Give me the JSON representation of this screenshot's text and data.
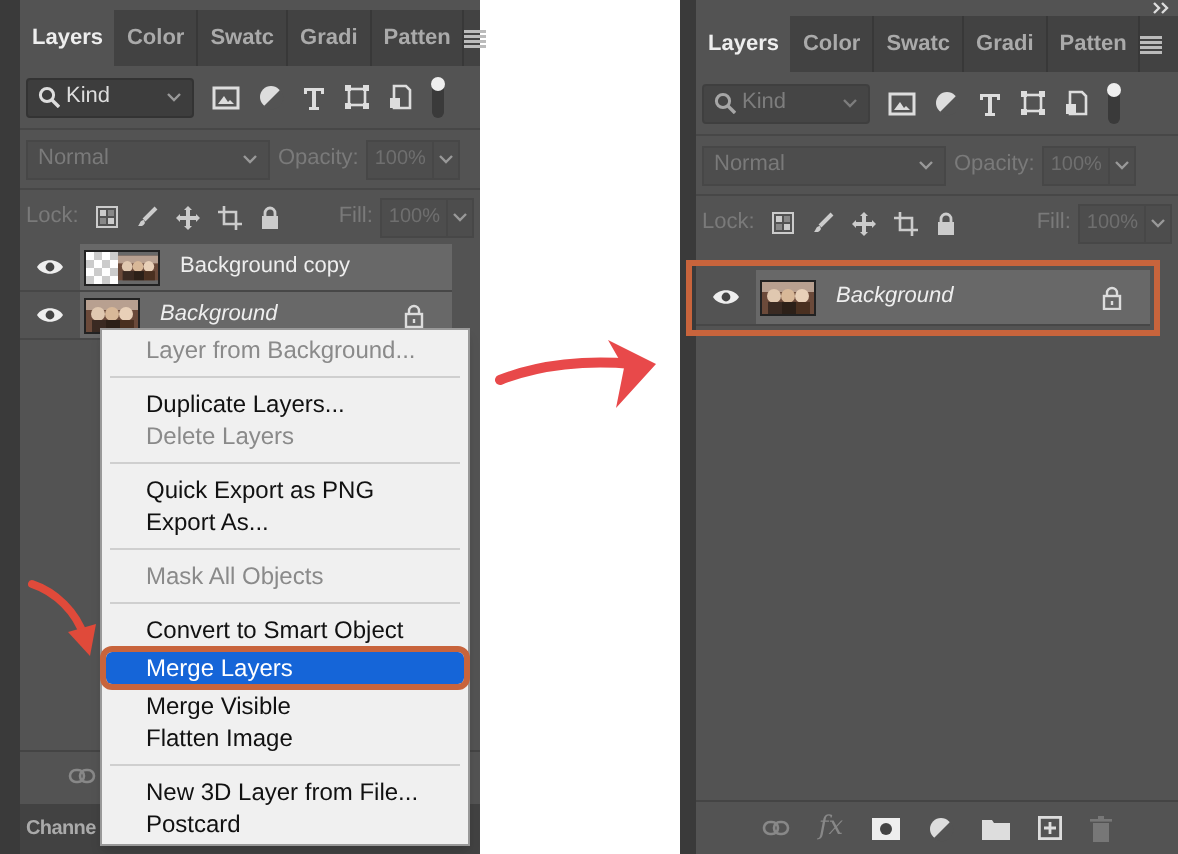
{
  "left_panel": {
    "tabs": [
      {
        "label": "Layers",
        "selected": true
      },
      {
        "label": "Color",
        "selected": false
      },
      {
        "label": "Swatc",
        "selected": false
      },
      {
        "label": "Gradi",
        "selected": false
      },
      {
        "label": "Patten",
        "selected": false
      }
    ],
    "filter": {
      "value": "Kind",
      "disabled": false
    },
    "blend_mode": "Normal",
    "opacity_label": "Opacity:",
    "opacity": "100%",
    "lock_label": "Lock:",
    "fill_label": "Fill:",
    "fill": "100%",
    "layers": [
      {
        "name": "Background copy",
        "kind": "normal",
        "visible": true,
        "selected": true,
        "locked": false,
        "annotated": false
      },
      {
        "name": "Background",
        "kind": "background",
        "visible": true,
        "selected": true,
        "locked": true,
        "annotated": false
      }
    ],
    "bottom_tab": "Channe"
  },
  "context_menu": {
    "groups": [
      [
        {
          "label": "Layer from Background...",
          "disabled": true,
          "selected": false,
          "annotated": false
        }
      ],
      [
        {
          "label": "Duplicate Layers...",
          "disabled": false,
          "selected": false,
          "annotated": false
        },
        {
          "label": "Delete Layers",
          "disabled": true,
          "selected": false,
          "annotated": false
        }
      ],
      [
        {
          "label": "Quick Export as PNG",
          "disabled": false,
          "selected": false,
          "annotated": false
        },
        {
          "label": "Export As...",
          "disabled": false,
          "selected": false,
          "annotated": false
        }
      ],
      [
        {
          "label": "Mask All Objects",
          "disabled": true,
          "selected": false,
          "annotated": false
        }
      ],
      [
        {
          "label": "Convert to Smart Object",
          "disabled": false,
          "selected": false,
          "annotated": false
        },
        {
          "label": "Merge Layers",
          "disabled": false,
          "selected": true,
          "annotated": true
        },
        {
          "label": "Merge Visible",
          "disabled": false,
          "selected": false,
          "annotated": false
        },
        {
          "label": "Flatten Image",
          "disabled": false,
          "selected": false,
          "annotated": false
        }
      ],
      [
        {
          "label": "New 3D Layer from File...",
          "disabled": false,
          "selected": false,
          "annotated": false
        },
        {
          "label": "Postcard",
          "disabled": false,
          "selected": false,
          "annotated": false
        }
      ]
    ]
  },
  "right_panel": {
    "tabs": [
      {
        "label": "Layers",
        "selected": true
      },
      {
        "label": "Color",
        "selected": false
      },
      {
        "label": "Swatc",
        "selected": false
      },
      {
        "label": "Gradi",
        "selected": false
      },
      {
        "label": "Patten",
        "selected": false
      }
    ],
    "filter": {
      "value": "Kind",
      "disabled": true
    },
    "blend_mode": "Normal",
    "opacity_label": "Opacity:",
    "opacity": "100%",
    "lock_label": "Lock:",
    "fill_label": "Fill:",
    "fill": "100%",
    "layers": [
      {
        "name": "Background",
        "kind": "background",
        "visible": true,
        "selected": true,
        "locked": true,
        "annotated": true
      }
    ],
    "fx": "fx"
  }
}
